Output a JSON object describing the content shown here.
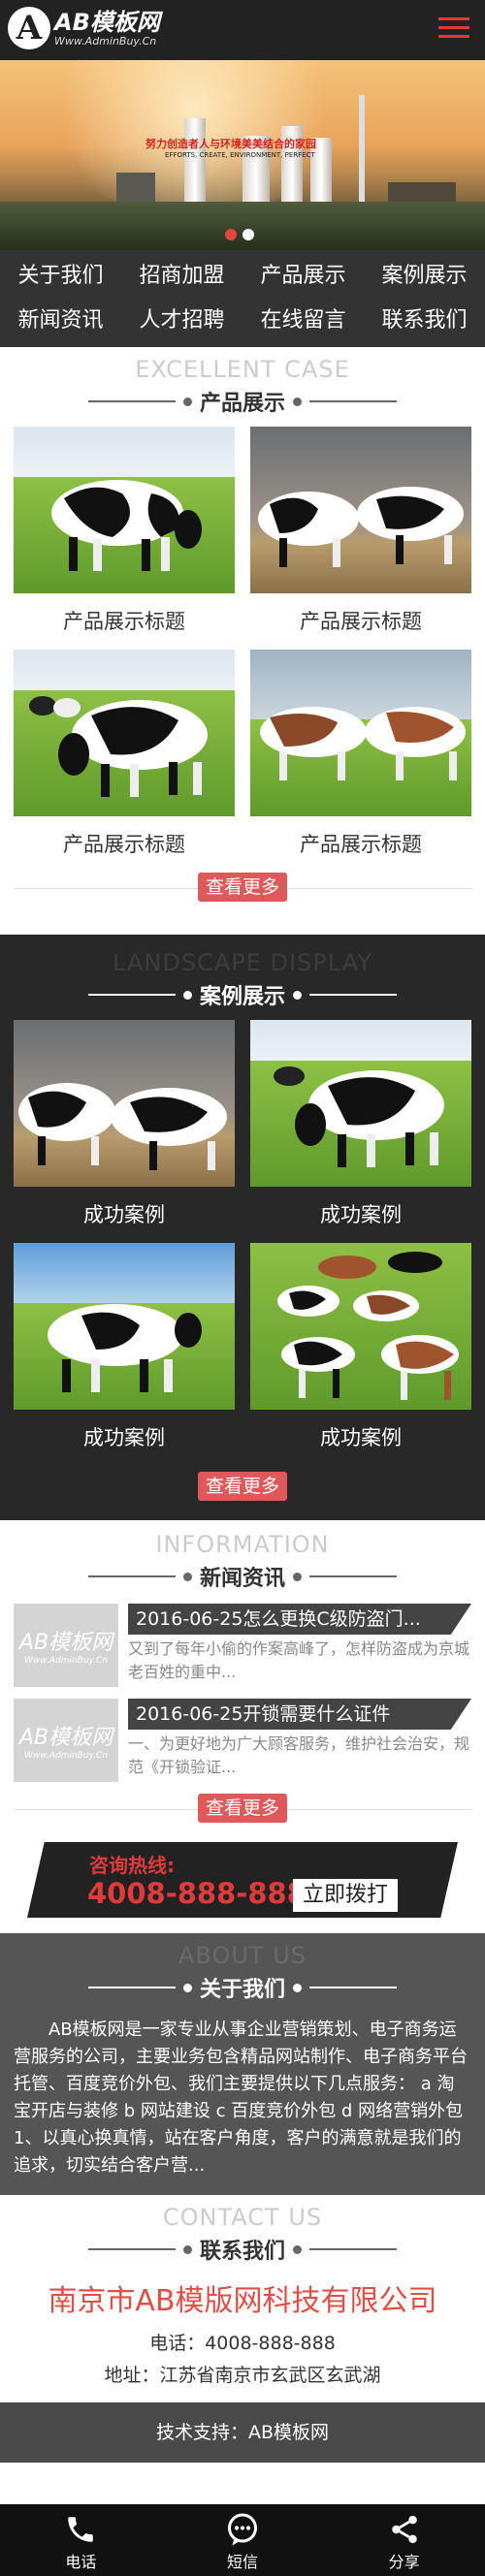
{
  "header": {
    "logo_mark": "A",
    "logo_title": "AB模板网",
    "logo_url": "Www.AdminBuy.Cn",
    "menu_icon": "hamburger-menu-icon"
  },
  "banner": {
    "slogan": "努力创造者人与环境美美结合的家园",
    "slogan_en": "EFFORTS, CREATE, ENVIRONMENT, PERFECT",
    "slide_count": 2,
    "active_slide": 1
  },
  "nav": [
    {
      "label": "关于我们"
    },
    {
      "label": "招商加盟"
    },
    {
      "label": "产品展示"
    },
    {
      "label": "案例展示"
    },
    {
      "label": "新闻资讯"
    },
    {
      "label": "人才招聘"
    },
    {
      "label": "在线留言"
    },
    {
      "label": "联系我们"
    }
  ],
  "products": {
    "en": "EXCELLENT CASE",
    "title": "产品展示",
    "items": [
      {
        "caption": "产品展示标题"
      },
      {
        "caption": "产品展示标题"
      },
      {
        "caption": "产品展示标题"
      },
      {
        "caption": "产品展示标题"
      }
    ],
    "more": "查看更多"
  },
  "cases": {
    "en": "LANDSCAPE DISPLAY",
    "title": "案例展示",
    "items": [
      {
        "caption": "成功案例"
      },
      {
        "caption": "成功案例"
      },
      {
        "caption": "成功案例"
      },
      {
        "caption": "成功案例"
      }
    ],
    "more": "查看更多"
  },
  "news": {
    "en": "INFORMATION",
    "title": "新闻资讯",
    "thumb_logo": "AB模板网",
    "thumb_url": "Www.AdminBuy.Cn",
    "items": [
      {
        "title": "2016-06-25怎么更换C级防盗门...",
        "desc": "又到了每年小偷的作案高峰了，怎样防盗成为京城老百姓的重中..."
      },
      {
        "title": "2016-06-25开锁需要什么证件",
        "desc": "一、为更好地为广大顾客服务，维护社会治安，规范《开锁验证..."
      }
    ],
    "more": "查看更多"
  },
  "hotline": {
    "label": "咨询热线:",
    "number": "4008-888-888",
    "button": "立即拨打"
  },
  "about": {
    "en": "ABOUT US",
    "title": "关于我们",
    "text": "AB模板网是一家专业从事企业营销策划、电子商务运营服务的公司，主要业务包含精品网站制作、电子商务平台托管、百度竞价外包、我们主要提供以下几点服务： a 淘宝开店与装修 b 网站建设 c 百度竞价外包 d 网络营销外包 1、以真心换真情，站在客户角度，客户的满意就是我们的追求，切实结合客户营..."
  },
  "contact": {
    "en": "CONTACT US",
    "title": "联系我们",
    "company": "南京市AB模版网科技有限公司",
    "phone": "电话：4008-888-888",
    "address": "地址：江苏省南京市玄武区玄武湖"
  },
  "support": "技术支持：AB模板网",
  "footer": [
    {
      "label": "电话",
      "icon": "phone-icon"
    },
    {
      "label": "短信",
      "icon": "message-icon"
    },
    {
      "label": "分享",
      "icon": "share-icon"
    }
  ],
  "colors": {
    "accent": "#e0595a",
    "hotline": "#e03a3a",
    "dark": "#282828"
  }
}
